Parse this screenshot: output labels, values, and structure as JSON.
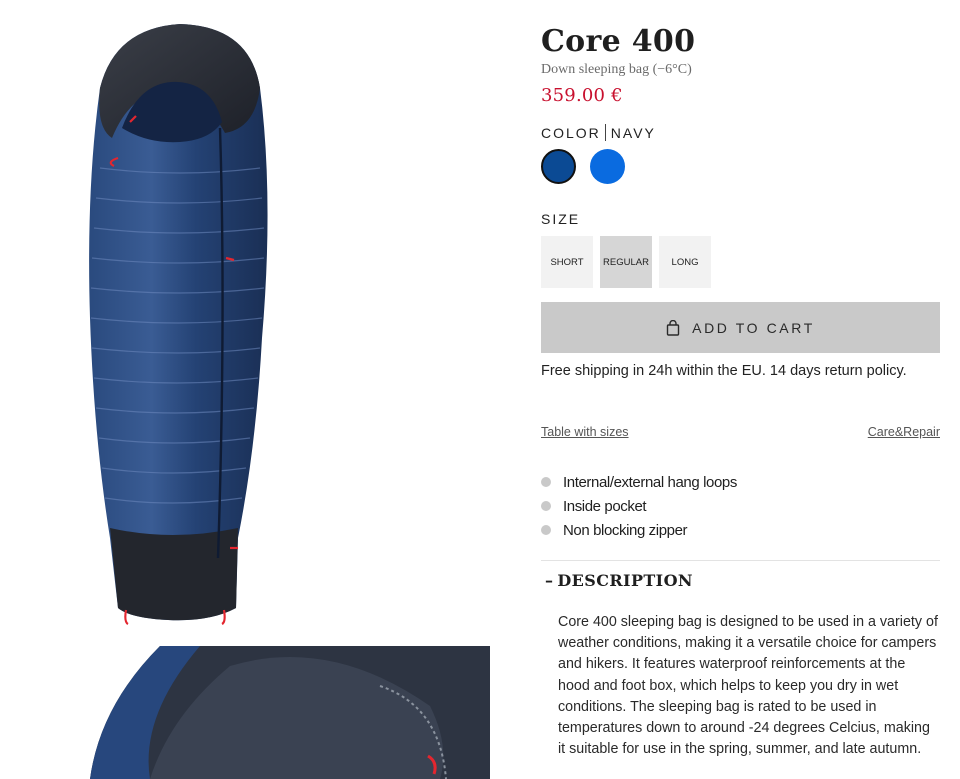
{
  "product": {
    "title": "Core 400",
    "subtitle": "Down sleeping bag (−6°C)",
    "price": "359.00 €"
  },
  "color": {
    "label": "COLOR",
    "selected_name": "NAVY",
    "swatches": [
      {
        "name": "navy",
        "hex": "#0b4a94",
        "selected": true
      },
      {
        "name": "blue",
        "hex": "#0a6be0",
        "selected": false
      }
    ]
  },
  "size": {
    "label": "SIZE",
    "options": [
      {
        "label": "SHORT",
        "selected": false
      },
      {
        "label": "REGULAR",
        "selected": true
      },
      {
        "label": "LONG",
        "selected": false
      }
    ]
  },
  "cart": {
    "button_label": "ADD TO CART",
    "icon": "shopping-bag-icon"
  },
  "shipping_note": "Free shipping in 24h within the EU. 14 days return policy.",
  "links": {
    "size_table": "Table with sizes",
    "care": "Care&Repair"
  },
  "features": [
    "Internal/external hang loops",
    "Inside pocket",
    "Non blocking zipper"
  ],
  "description": {
    "toggle": "–",
    "heading": "DESCRIPTION",
    "body": "Core 400 sleeping bag is designed to be used in a variety of weather conditions, making it a versatile choice for campers and hikers. It features waterproof reinforcements at the hood and foot box, which helps to keep you dry in wet conditions. The sleeping bag is rated to be used in temperatures down to around -24 degrees Celcius, making it suitable for use in the spring, summer, and late autumn."
  },
  "colors": {
    "price": "#c8102e",
    "button_bg": "#c9c9c9",
    "bag_shell": "#1f3a66",
    "accent_red": "#e3262f"
  }
}
